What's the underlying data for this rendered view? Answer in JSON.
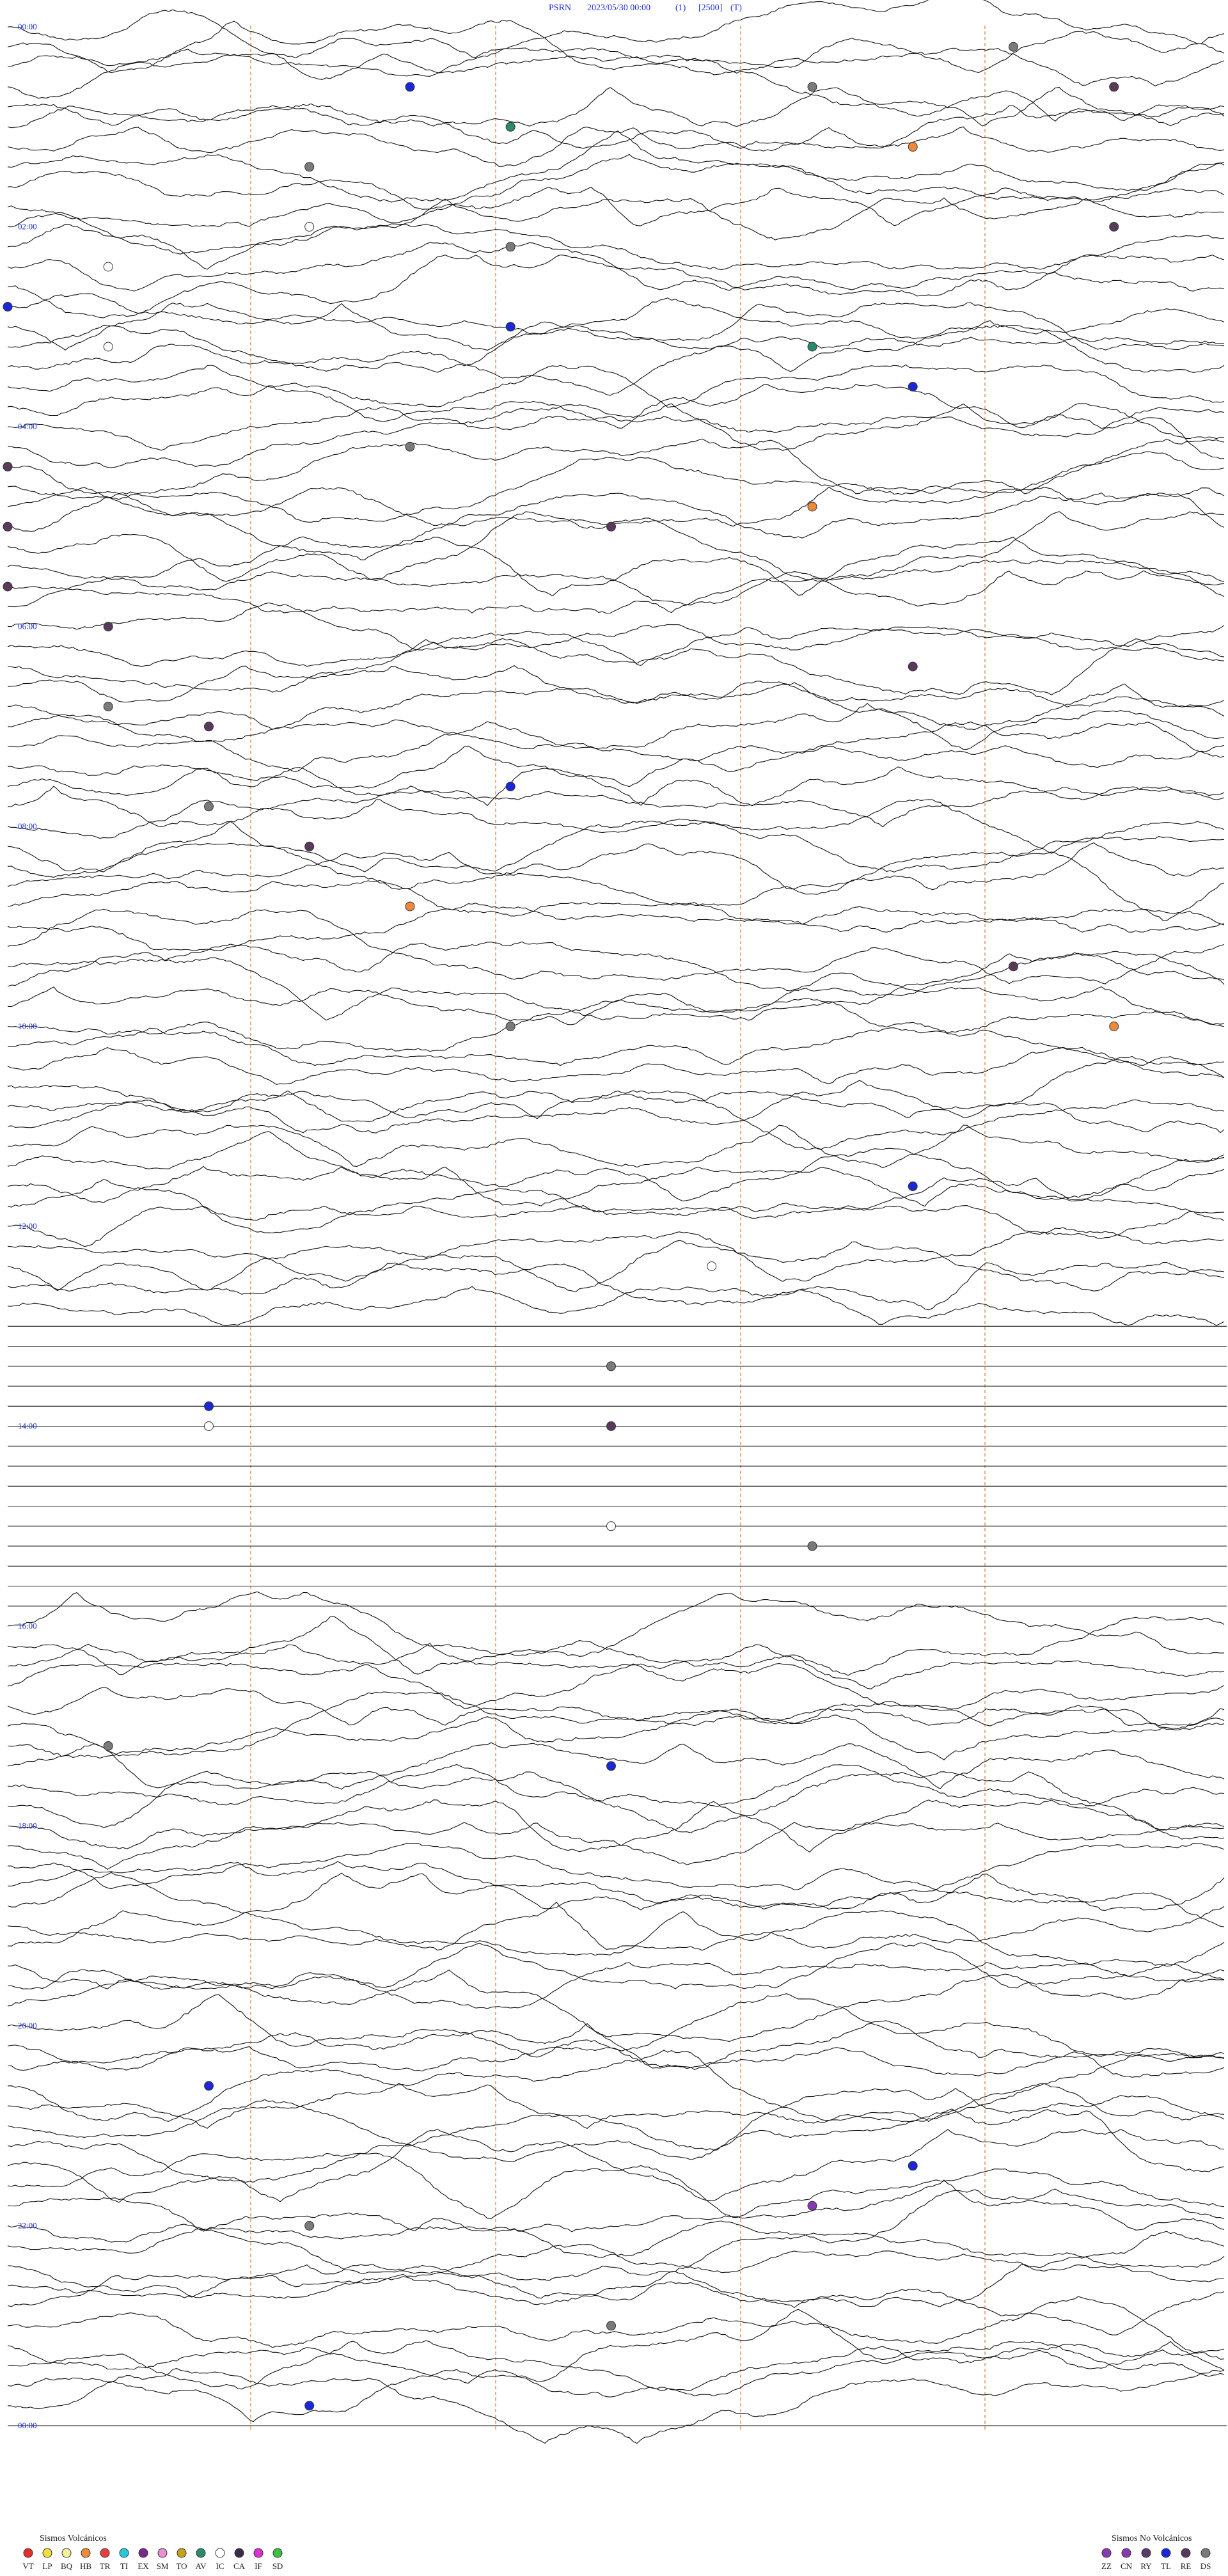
{
  "header": {
    "station": "PSRN",
    "datetime": "2023/05/30 00:00",
    "param1": "(1)",
    "param2": "[2500]",
    "param3": "(T)"
  },
  "chart_data": {
    "type": "helicorder",
    "start": "2023/05/30 00:00",
    "end": "2023/05/31 00:00",
    "rows_per_hour": 5,
    "total_rows": 121,
    "minute_markers": [
      15,
      30,
      45,
      60
    ],
    "hour_labels": [
      "00:00",
      "02:00",
      "04:00",
      "06:00",
      "08:00",
      "10:00",
      "12:00",
      "14:00",
      "16:00",
      "18:00",
      "20:00",
      "22:00",
      "00:00"
    ],
    "label_every_hours": 2,
    "noisy_periods": [
      {
        "from": "00:00",
        "to": "12:50",
        "level": "high"
      },
      {
        "from": "12:50",
        "to": "15:50",
        "level": "quiet"
      },
      {
        "from": "15:50",
        "to": "23:59",
        "level": "high"
      }
    ],
    "events": [
      {
        "time": "00:22",
        "type": "DS"
      },
      {
        "time": "00:44",
        "type": "DS"
      },
      {
        "time": "00:40",
        "type": "TL"
      },
      {
        "time": "00:47",
        "type": "RE"
      },
      {
        "time": "01:05",
        "type": "AV"
      },
      {
        "time": "01:21",
        "type": "HB"
      },
      {
        "time": "01:27",
        "type": "DS"
      },
      {
        "time": "02:03",
        "type": "IC"
      },
      {
        "time": "02:11",
        "type": "RE"
      },
      {
        "time": "02:17",
        "type": "DS"
      },
      {
        "time": "02:25",
        "type": "IC"
      },
      {
        "time": "02:48",
        "type": "TL"
      },
      {
        "time": "03:05",
        "type": "TL"
      },
      {
        "time": "03:13",
        "type": "IC"
      },
      {
        "time": "03:20",
        "type": "AV"
      },
      {
        "time": "03:45",
        "type": "TL"
      },
      {
        "time": "04:16",
        "type": "DS"
      },
      {
        "time": "04:24",
        "type": "RE"
      },
      {
        "time": "04:56",
        "type": "HB"
      },
      {
        "time": "05:00",
        "type": "RE"
      },
      {
        "time": "05:06",
        "type": "RE"
      },
      {
        "time": "05:36",
        "type": "RE"
      },
      {
        "time": "06:01",
        "type": "RE"
      },
      {
        "time": "06:33",
        "type": "RE"
      },
      {
        "time": "06:49",
        "type": "DS"
      },
      {
        "time": "07:02",
        "type": "RE"
      },
      {
        "time": "07:41",
        "type": "TL"
      },
      {
        "time": "07:50",
        "type": "DS"
      },
      {
        "time": "08:15",
        "type": "RE"
      },
      {
        "time": "08:52",
        "type": "HB"
      },
      {
        "time": "09:34",
        "type": "RE"
      },
      {
        "time": "10:05",
        "type": "DS"
      },
      {
        "time": "10:11",
        "type": "HB"
      },
      {
        "time": "11:45",
        "type": "TL"
      },
      {
        "time": "12:31",
        "type": "IC"
      },
      {
        "time": "13:30",
        "type": "DS"
      },
      {
        "time": "13:50",
        "type": "TL"
      },
      {
        "time": "14:02",
        "type": "IC"
      },
      {
        "time": "14:06",
        "type": "RE"
      },
      {
        "time": "15:20",
        "type": "DS"
      },
      {
        "time": "15:06",
        "type": "IC"
      },
      {
        "time": "17:13",
        "type": "DS"
      },
      {
        "time": "17:30",
        "type": "TL"
      },
      {
        "time": "20:38",
        "type": "TL"
      },
      {
        "time": "21:33",
        "type": "TL"
      },
      {
        "time": "21:56",
        "type": "CN"
      },
      {
        "time": "22:03",
        "type": "DS"
      },
      {
        "time": "23:06",
        "type": "DS"
      },
      {
        "time": "23:51",
        "type": "TL"
      }
    ],
    "legend": {
      "volcanic_title": "Sismos Volcánicos",
      "volcanic": [
        {
          "code": "VT",
          "color": "#e0302a"
        },
        {
          "code": "LP",
          "color": "#f2e03a"
        },
        {
          "code": "BQ",
          "color": "#f3f0a0"
        },
        {
          "code": "HB",
          "color": "#f08a3a"
        },
        {
          "code": "TR",
          "color": "#e84040"
        },
        {
          "code": "TI",
          "color": "#28c8d8"
        },
        {
          "code": "EX",
          "color": "#7a2a8a"
        },
        {
          "code": "SM",
          "color": "#e890d0"
        },
        {
          "code": "TO",
          "color": "#c8a020"
        },
        {
          "code": "AV",
          "color": "#2a8a6a"
        },
        {
          "code": "IC",
          "color": "#ffffff"
        },
        {
          "code": "CA",
          "color": "#3a2a4a"
        },
        {
          "code": "IF",
          "color": "#e030d0"
        },
        {
          "code": "SD",
          "color": "#40c040"
        }
      ],
      "nonvolcanic_title": "Sismos No Volcánicos",
      "nonvolcanic": [
        {
          "code": "ZZ",
          "color": "#8a3ab0"
        },
        {
          "code": "CN",
          "color": "#8a3ab0"
        },
        {
          "code": "RY",
          "color": "#5a3a6a"
        },
        {
          "code": "TL",
          "color": "#1a28d8"
        },
        {
          "code": "RE",
          "color": "#5a3a5a"
        },
        {
          "code": "DS",
          "color": "#7a7a7a"
        }
      ]
    }
  }
}
